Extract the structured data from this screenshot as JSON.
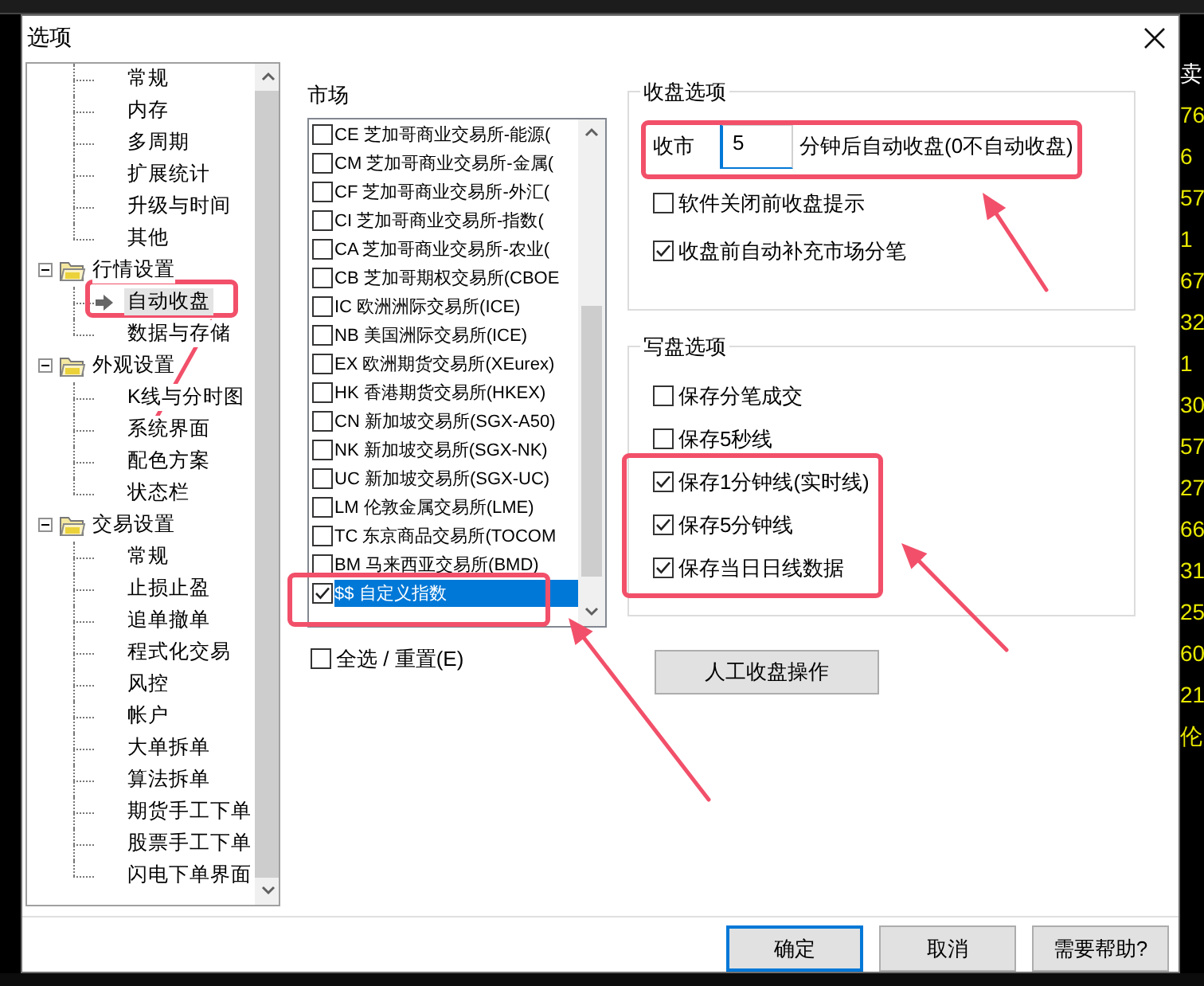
{
  "window": {
    "title": "选项"
  },
  "tree": [
    {
      "expanded": true,
      "children": [
        {
          "label": "常规",
          "selected": false
        },
        {
          "label": "内存",
          "selected": false
        },
        {
          "label": "多周期",
          "selected": false
        },
        {
          "label": "扩展统计",
          "selected": false
        },
        {
          "label": "升级与时间",
          "selected": false
        },
        {
          "label": "其他",
          "selected": false
        }
      ]
    },
    {
      "label": "行情设置",
      "expanded": true,
      "children": [
        {
          "label": "自动收盘",
          "selected": true
        },
        {
          "label": "数据与存储",
          "selected": false
        }
      ]
    },
    {
      "label": "外观设置",
      "expanded": true,
      "children": [
        {
          "label": "K线与分时图",
          "selected": false
        },
        {
          "label": "系统界面",
          "selected": false
        },
        {
          "label": "配色方案",
          "selected": false
        },
        {
          "label": "状态栏",
          "selected": false
        }
      ]
    },
    {
      "label": "交易设置",
      "expanded": true,
      "children": [
        {
          "label": "常规",
          "selected": false
        },
        {
          "label": "止损止盈",
          "selected": false
        },
        {
          "label": "追单撤单",
          "selected": false
        },
        {
          "label": "程式化交易",
          "selected": false
        },
        {
          "label": "风控",
          "selected": false
        },
        {
          "label": "帐户",
          "selected": false
        },
        {
          "label": "大单拆单",
          "selected": false
        },
        {
          "label": "算法拆单",
          "selected": false
        },
        {
          "label": "期货手工下单",
          "selected": false
        },
        {
          "label": "股票手工下单",
          "selected": false
        },
        {
          "label": "闪电下单界面",
          "selected": false
        }
      ]
    }
  ],
  "market": {
    "label": "市场",
    "items": [
      {
        "text": "CE 芝加哥商业交易所-能源(",
        "checked": false,
        "selected": false
      },
      {
        "text": "CM 芝加哥商业交易所-金属(",
        "checked": false,
        "selected": false
      },
      {
        "text": "CF 芝加哥商业交易所-外汇(",
        "checked": false,
        "selected": false
      },
      {
        "text": "CI 芝加哥商业交易所-指数(",
        "checked": false,
        "selected": false
      },
      {
        "text": "CA 芝加哥商业交易所-农业(",
        "checked": false,
        "selected": false
      },
      {
        "text": "CB 芝加哥期权交易所(CBOE",
        "checked": false,
        "selected": false
      },
      {
        "text": "IC 欧洲洲际交易所(ICE)",
        "checked": false,
        "selected": false
      },
      {
        "text": "NB 美国洲际交易所(ICE)",
        "checked": false,
        "selected": false
      },
      {
        "text": "EX 欧洲期货交易所(XEurex)",
        "checked": false,
        "selected": false
      },
      {
        "text": "HK 香港期货交易所(HKEX)",
        "checked": false,
        "selected": false
      },
      {
        "text": "CN 新加坡交易所(SGX-A50)",
        "checked": false,
        "selected": false
      },
      {
        "text": "NK 新加坡交易所(SGX-NK)",
        "checked": false,
        "selected": false
      },
      {
        "text": "UC 新加坡交易所(SGX-UC)",
        "checked": false,
        "selected": false
      },
      {
        "text": "LM 伦敦金属交易所(LME)",
        "checked": false,
        "selected": false
      },
      {
        "text": "TC 东京商品交易所(TOCOM",
        "checked": false,
        "selected": false
      },
      {
        "text": "BM 马来西亚交易所(BMD)",
        "checked": false,
        "selected": false
      },
      {
        "text": "$$ 自定义指数",
        "checked": true,
        "selected": true
      }
    ],
    "select_all": {
      "label": "全选 / 重置(E)",
      "checked": false
    }
  },
  "close_options": {
    "title": "收盘选项",
    "prefix": "收市",
    "minutes": "5",
    "suffix": "分钟后自动收盘(0不自动收盘)",
    "checks": [
      {
        "label": "软件关闭前收盘提示",
        "checked": false
      },
      {
        "label": "收盘前自动补充市场分笔",
        "checked": true
      }
    ]
  },
  "write_options": {
    "title": "写盘选项",
    "checks": [
      {
        "label": "保存分笔成交",
        "checked": false
      },
      {
        "label": "保存5秒线",
        "checked": false
      },
      {
        "label": "保存1分钟线(实时线)",
        "checked": true
      },
      {
        "label": "保存5分钟线",
        "checked": true
      },
      {
        "label": "保存当日日线数据",
        "checked": true
      }
    ]
  },
  "manual_button": "人工收盘操作",
  "buttons": [
    {
      "label": "确定",
      "default": true
    },
    {
      "label": "取消",
      "default": false
    },
    {
      "label": "需要帮助?",
      "default": false
    }
  ],
  "background": {
    "right_column": [
      "卖",
      "76",
      "6",
      "57",
      "1",
      "67",
      "32",
      "1",
      "30",
      "57",
      "27",
      "66",
      "31",
      "25",
      "60",
      "21",
      "伦"
    ]
  }
}
